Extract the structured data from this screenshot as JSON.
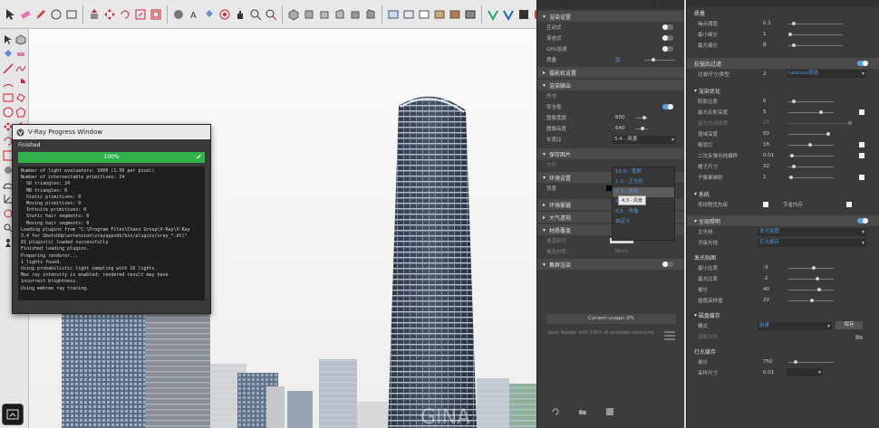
{
  "progress_window": {
    "title": "V-Ray Progress Window",
    "status": "Finished",
    "progress_percent": 100,
    "progress_label": "100%",
    "log": "Number of light evaluators: 1000 (1.50 per pixel)\nNumber of intersectable primitives: 24\n  SD triangles: 24\n  MB triangles: 0\n  Static primitives: 0\n  Moving primitives: 0\n  Infinite primitives: 0\n  Static hair segments: 0\n  Moving hair segments: 0\nLoading plugins from \"C:\\Program Files\\Chaos Group\\V-Ray\\V-Ray\n3.4 for SketchUp\\extension\\vrayappsdk/bin/plugins/vray_*.dll\"\n81 plugin(s) loaded successfully\nFinished loading plugins.\nPreparing renderer...\n1 lights found.\nUsing probabilistic light sampling with 16 lights.\nMax ray intensity is enabled: rendered result may have\nincorrect brightness.\nUsing embree ray tracing."
  },
  "settings_left": {
    "render_section": "渲染设置",
    "rows_render": [
      {
        "label": "互动式",
        "toggle": "off"
      },
      {
        "label": "渐进式",
        "toggle": "off"
      },
      {
        "label": "GPU加速",
        "toggle": "off"
      }
    ],
    "quality_label": "质量",
    "quality_value": "低",
    "camera_section": "摄影机设置",
    "output_section": "渲染输出",
    "size_label": "尺寸",
    "safe_frame_label": "安全框",
    "width_label": "图像宽度",
    "width_value": "800",
    "height_label": "图像高度",
    "height_value": "640",
    "aspect_label": "长宽比",
    "aspect_value": "5:4 - 风景",
    "save_section": "保存图片",
    "file_label": "文件",
    "env_section": "环境设置",
    "background_label": "背景",
    "env_fog_section": "环境雾霾",
    "atmos_section": "大气透视",
    "material_section": "材质覆盖",
    "override_color_label": "覆盖颜色",
    "override_material_label": "覆盖材质",
    "override_material_value": "None",
    "swarm_section": "集群渲染",
    "usage": "Current usage: 0%",
    "note": "Goal: Render with 100% of available resources"
  },
  "aspect_menu": {
    "items": [
      "16:9 - 宽屏",
      "1:1 - 正方形",
      "4:3 - 风景",
      "5:4 - 风景",
      "4:5 - 肖像",
      "自定义"
    ],
    "tooltip": "4:3 - 风景"
  },
  "settings_right": {
    "quality_head": "质量",
    "noise_label": "噪点阈值",
    "noise_value": "0.1",
    "min_sub_label": "最小细分",
    "min_sub_value": "1",
    "max_sub_label": "最大细分",
    "max_sub_value": "8",
    "aa_head": "抗锯齿过滤",
    "filter_label": "过滤尺寸/类型",
    "filter_value": "2",
    "filter_type": "Lanczos筛选",
    "opt_head": "渲染优化",
    "shading_label": "阴影比率",
    "shading_value": "6",
    "max_depth_label": "最大反射深度",
    "max_depth_value": "5",
    "max_trans_label": "最大光线强度",
    "max_trans_value": "20",
    "clamp_label": "值域深度",
    "clamp_value": "50",
    "probab_label": "概率灯",
    "probab_value": "16",
    "secondary_label": "二次反弹光线偏移",
    "secondary_value": "0.01",
    "bucket_label": "桶子尺寸",
    "bucket_value": "32",
    "subdiv_label": "子像素映射",
    "subdiv_value": "1",
    "system_head": "系统",
    "lowthread_label": "低线程优先级",
    "memory_label": "节省内存",
    "gi_head": "全局照明",
    "primary_label": "主光线",
    "primary_value": "发光贴图",
    "secondary_gi_label": "次级光线",
    "secondary_gi_value": "灯光缓存",
    "irr_head": "发光贴图",
    "min_rate_label": "最小比率",
    "min_rate_value": "-3",
    "max_rate_label": "最大比率",
    "max_rate_value": "-2",
    "subdivs_label": "细分",
    "subdivs_value": "40",
    "interp_label": "插值采样值",
    "interp_value": "20",
    "disk_head": "磁盘缓存",
    "mode_label": "模式",
    "mode_value": "新建",
    "save_button": "保存",
    "file_label": "加载文件",
    "lc_head": "灯光缓存",
    "lc_subdiv_label": "细分",
    "lc_subdiv_value": "750",
    "lc_sample_label": "采样尺寸",
    "lc_sample_value": "0.01"
  }
}
